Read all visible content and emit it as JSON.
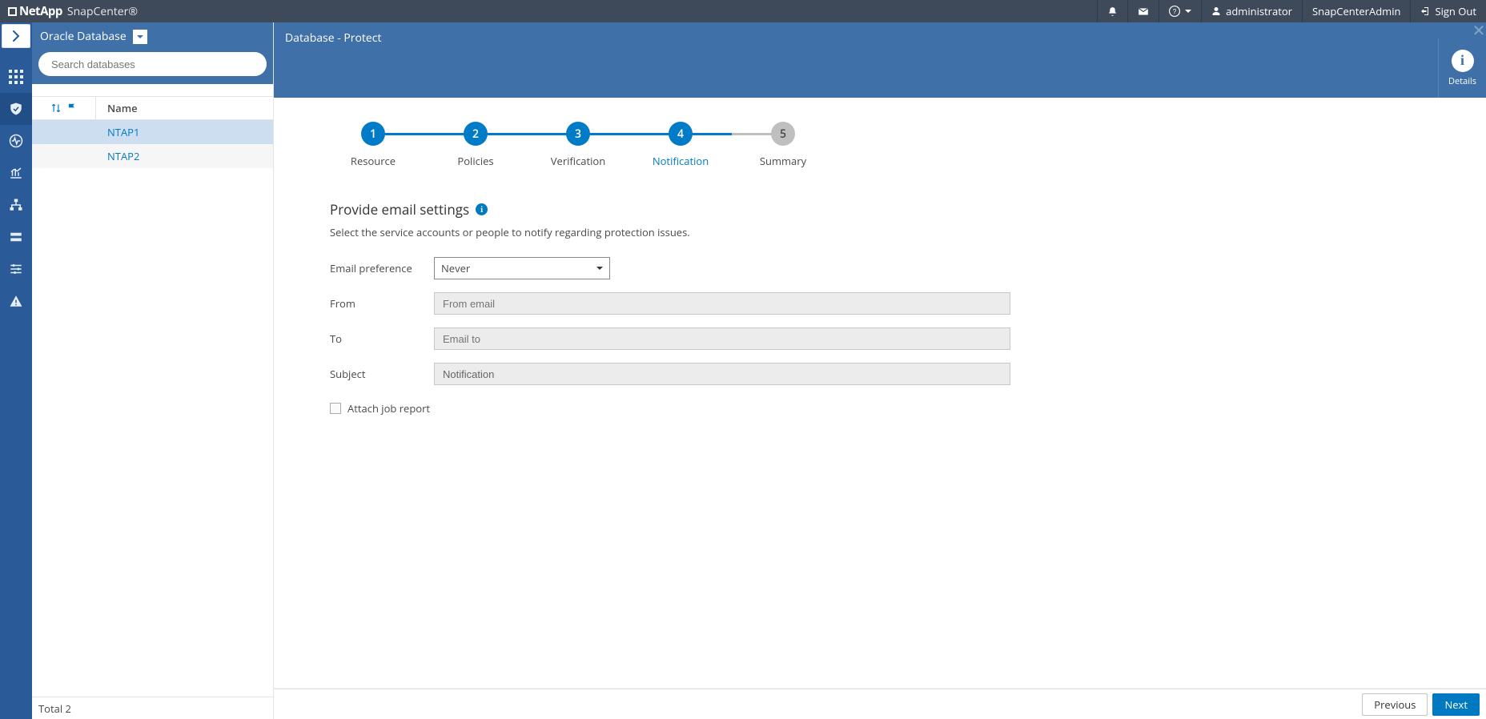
{
  "brand": {
    "company": "NetApp",
    "product": "SnapCenter®"
  },
  "topbar": {
    "user": "administrator",
    "role": "SnapCenterAdmin",
    "signout": "Sign Out"
  },
  "sidebar": {
    "resource_type_label": "Oracle Database",
    "search_placeholder": "Search databases",
    "columns": {
      "name": "Name"
    },
    "rows": [
      {
        "name": "NTAP1",
        "selected": true
      },
      {
        "name": "NTAP2",
        "selected": false
      }
    ],
    "footer": "Total 2"
  },
  "main": {
    "title": "Database - Protect",
    "details_label": "Details"
  },
  "steps": [
    {
      "num": "1",
      "label": "Resource",
      "state": "done"
    },
    {
      "num": "2",
      "label": "Policies",
      "state": "done"
    },
    {
      "num": "3",
      "label": "Verification",
      "state": "done"
    },
    {
      "num": "4",
      "label": "Notification",
      "state": "active"
    },
    {
      "num": "5",
      "label": "Summary",
      "state": "pending"
    }
  ],
  "form": {
    "title": "Provide email settings",
    "subtitle": "Select the service accounts or people to notify regarding protection issues.",
    "email_pref_label": "Email preference",
    "email_pref_value": "Never",
    "from_label": "From",
    "from_placeholder": "From email",
    "to_label": "To",
    "to_placeholder": "Email to",
    "subject_label": "Subject",
    "subject_value": "Notification",
    "attach_label": "Attach job report"
  },
  "footer": {
    "prev": "Previous",
    "next": "Next"
  }
}
